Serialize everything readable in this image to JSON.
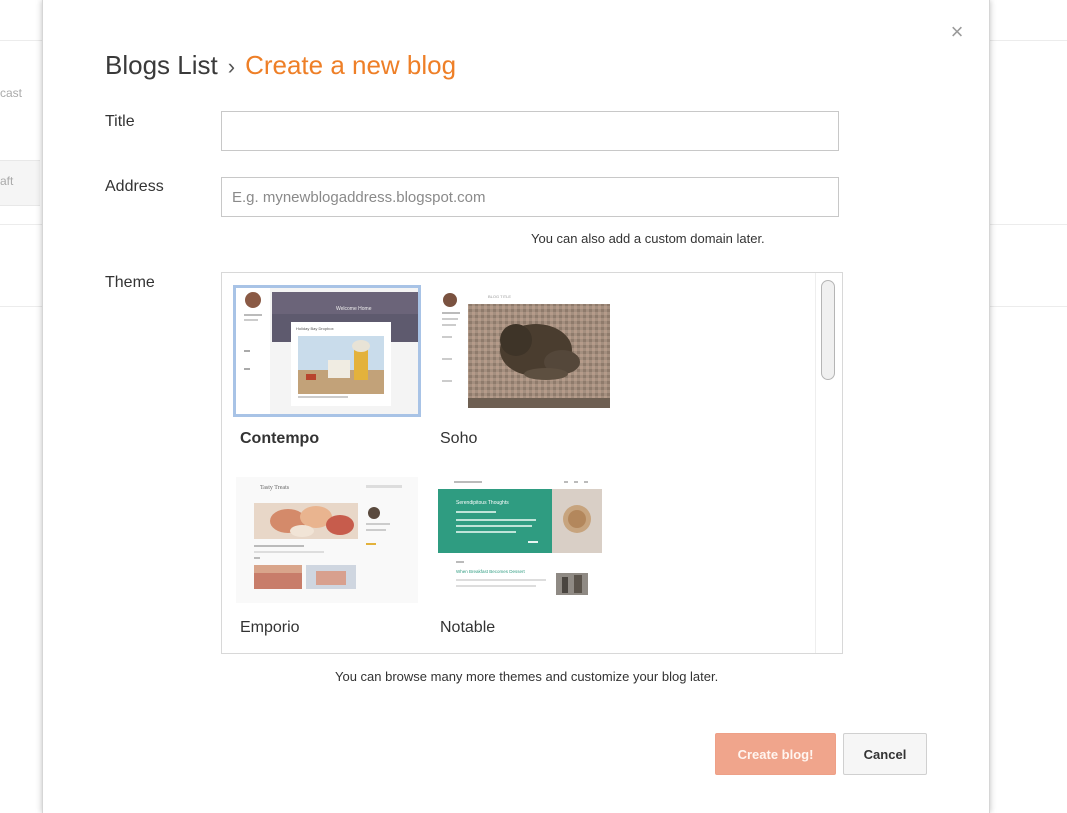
{
  "background": {
    "frag1": "cast",
    "frag2": "aft"
  },
  "dialog": {
    "breadcrumb_parent": "Blogs List",
    "breadcrumb_separator": "›",
    "breadcrumb_current": "Create a new blog",
    "close_symbol": "×",
    "close_icon": "close-icon"
  },
  "form": {
    "title_label": "Title",
    "title_value": "",
    "address_label": "Address",
    "address_value": "",
    "address_placeholder": "E.g. mynewblogaddress.blogspot.com",
    "address_hint": "You can also add a custom domain later.",
    "theme_label": "Theme",
    "theme_hint": "You can browse many more themes and customize your blog later."
  },
  "themes": [
    {
      "name": "Contempo",
      "selected": true
    },
    {
      "name": "Soho",
      "selected": false
    },
    {
      "name": "Emporio",
      "selected": false
    },
    {
      "name": "Notable",
      "selected": false
    }
  ],
  "thumb_text": {
    "contempo_header": "Welcome Home",
    "contempo_post": "Holiday Bay Dropbox",
    "soho_header": "BLOG TITLE",
    "emporio_title": "Tasty Treats",
    "notable_title": "Serendipitous Thoughts",
    "notable_link": "When Breakfast Becomes Dessert"
  },
  "actions": {
    "create_label": "Create blog!",
    "cancel_label": "Cancel"
  },
  "colors": {
    "accent": "#ee7f27",
    "create_button": "#f0a58c",
    "selection_outline": "#a8c3e6"
  }
}
